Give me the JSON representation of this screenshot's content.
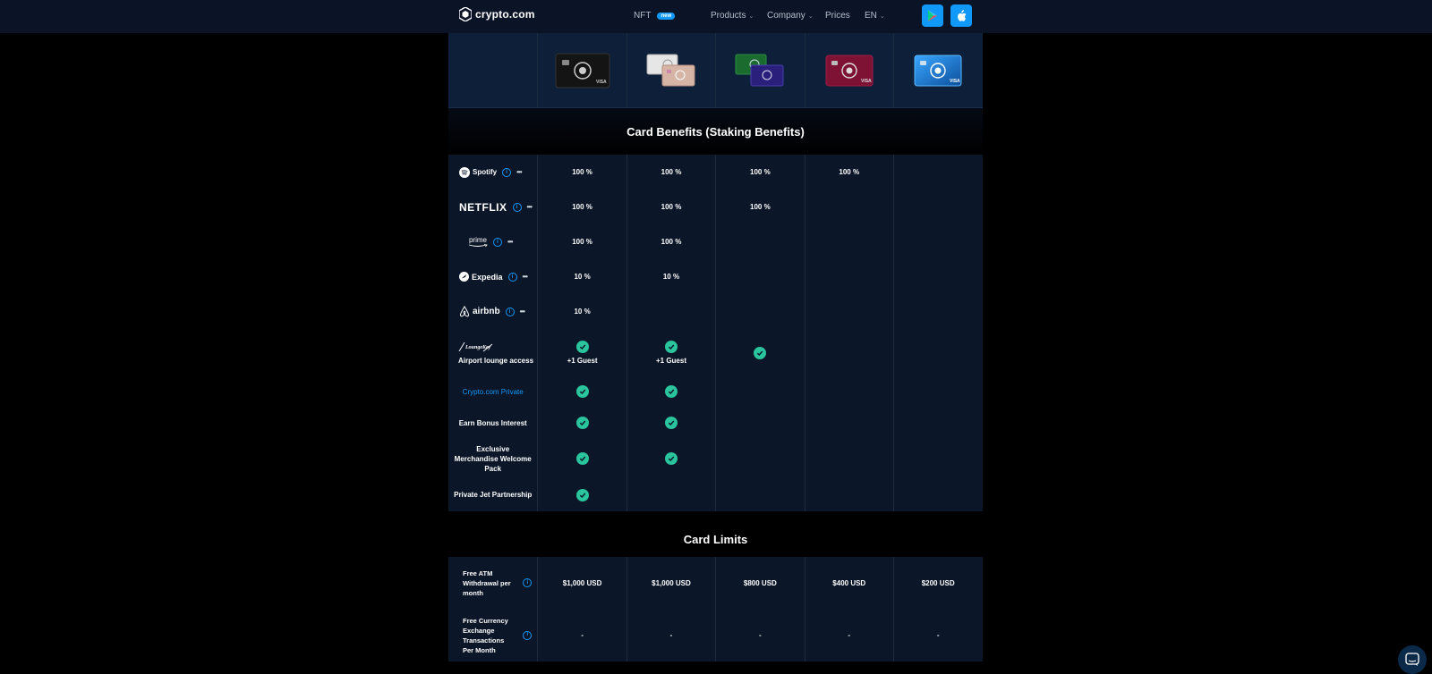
{
  "nav": {
    "brand": "crypto.com",
    "nft_label": "NFT",
    "nft_badge": "new",
    "products_label": "Products",
    "company_label": "Company",
    "prices_label": "Prices",
    "lang_label": "EN",
    "google_play_icon": "google-play-icon",
    "apple_icon": "apple-icon"
  },
  "cards": [
    {
      "name": "obsidian-card",
      "color": "#111111"
    },
    {
      "name": "frosted-rose-gold-card",
      "color": "#d8c3bb"
    },
    {
      "name": "jade-indigo-card",
      "color": "#1f7a3a"
    },
    {
      "name": "ruby-steel-card",
      "color": "#8b1538"
    },
    {
      "name": "royal-indigo-card",
      "color": "#1b6fbf"
    }
  ],
  "benefits": {
    "title": "Card Benefits (Staking Benefits)",
    "rows": [
      {
        "brand": "Spotify",
        "values": [
          "100 %",
          "100 %",
          "100 %",
          "100 %",
          ""
        ]
      },
      {
        "brand": "NETFLIX",
        "values": [
          "100 %",
          "100 %",
          "100 %",
          "",
          ""
        ]
      },
      {
        "brand": "prime",
        "values": [
          "100 %",
          "100 %",
          "",
          "",
          ""
        ]
      },
      {
        "brand": "Expedia",
        "values": [
          "10 %",
          "10 %",
          "",
          "",
          ""
        ]
      },
      {
        "brand": "airbnb",
        "values": [
          "10 %",
          "",
          "",
          "",
          ""
        ]
      }
    ],
    "lounge": {
      "brand": "LoungeKey",
      "label": "Airport lounge access",
      "guest": "+1 Guest"
    },
    "private_label": "Crypto.com Private",
    "bonus_label": "Earn Bonus Interest",
    "merch_label": "Exclusive Merchandise Welcome Pack",
    "jet_label": "Private Jet Partnership"
  },
  "limits": {
    "title": "Card Limits",
    "atm_label": "Free ATM Withdrawal per month",
    "atm_values": [
      "$1,000 USD",
      "$1,000 USD",
      "$800 USD",
      "$400 USD",
      "$200 USD"
    ],
    "fx_label": "Free Currency Exchange Transactions Per Month",
    "fx_values": [
      "-",
      "-",
      "-",
      "-",
      "-"
    ]
  },
  "colors": {
    "accent": "#1199fa",
    "check": "#2ac59d",
    "nav_bg": "#0b1426",
    "table_bg": "#0b1628"
  }
}
